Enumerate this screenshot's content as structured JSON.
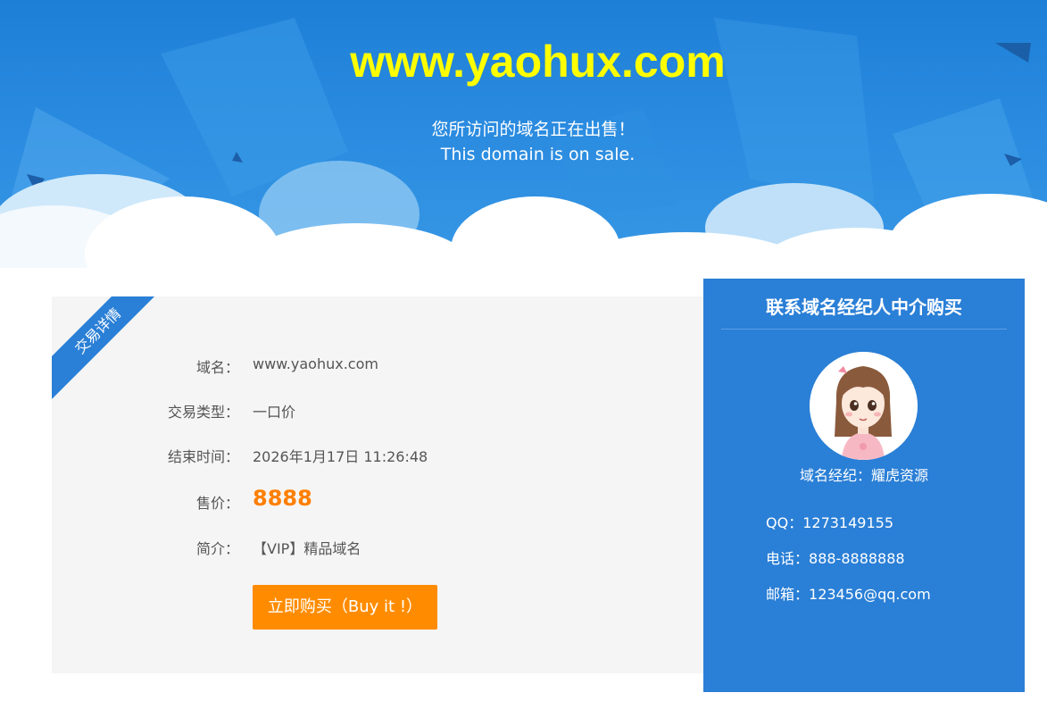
{
  "header": {
    "domain_title": "www.yaohux.com",
    "subtitle_cn": "您所访问的域名正在出售！",
    "subtitle_en": "This domain is on sale."
  },
  "details": {
    "ribbon_label": "交易详情",
    "rows": [
      {
        "label": "域名：",
        "value": "www.yaohux.com"
      },
      {
        "label": "交易类型：",
        "value": "一口价"
      },
      {
        "label": "结束时间：",
        "value": "2026年1月17日 11:26:48"
      },
      {
        "label": "售价：",
        "value": "8888"
      },
      {
        "label": "简介：",
        "value": "【VIP】精品域名"
      }
    ],
    "buy_button_label": "立即购买（Buy it !）"
  },
  "broker": {
    "title": "联系域名经纪人中介购买",
    "agent_name": "域名经纪：耀虎资源",
    "qq_label": "QQ：",
    "qq": "1273149155",
    "phone_label": "电话：",
    "phone": "888-8888888",
    "email_label": "邮箱：",
    "email": "123456@qq.com"
  },
  "colors": {
    "title_yellow": "#ffff00",
    "primary_blue": "#2a7fd6",
    "price_orange": "#ff7f00",
    "button_orange": "#ff8c00",
    "panel_gray": "#f5f5f5"
  }
}
